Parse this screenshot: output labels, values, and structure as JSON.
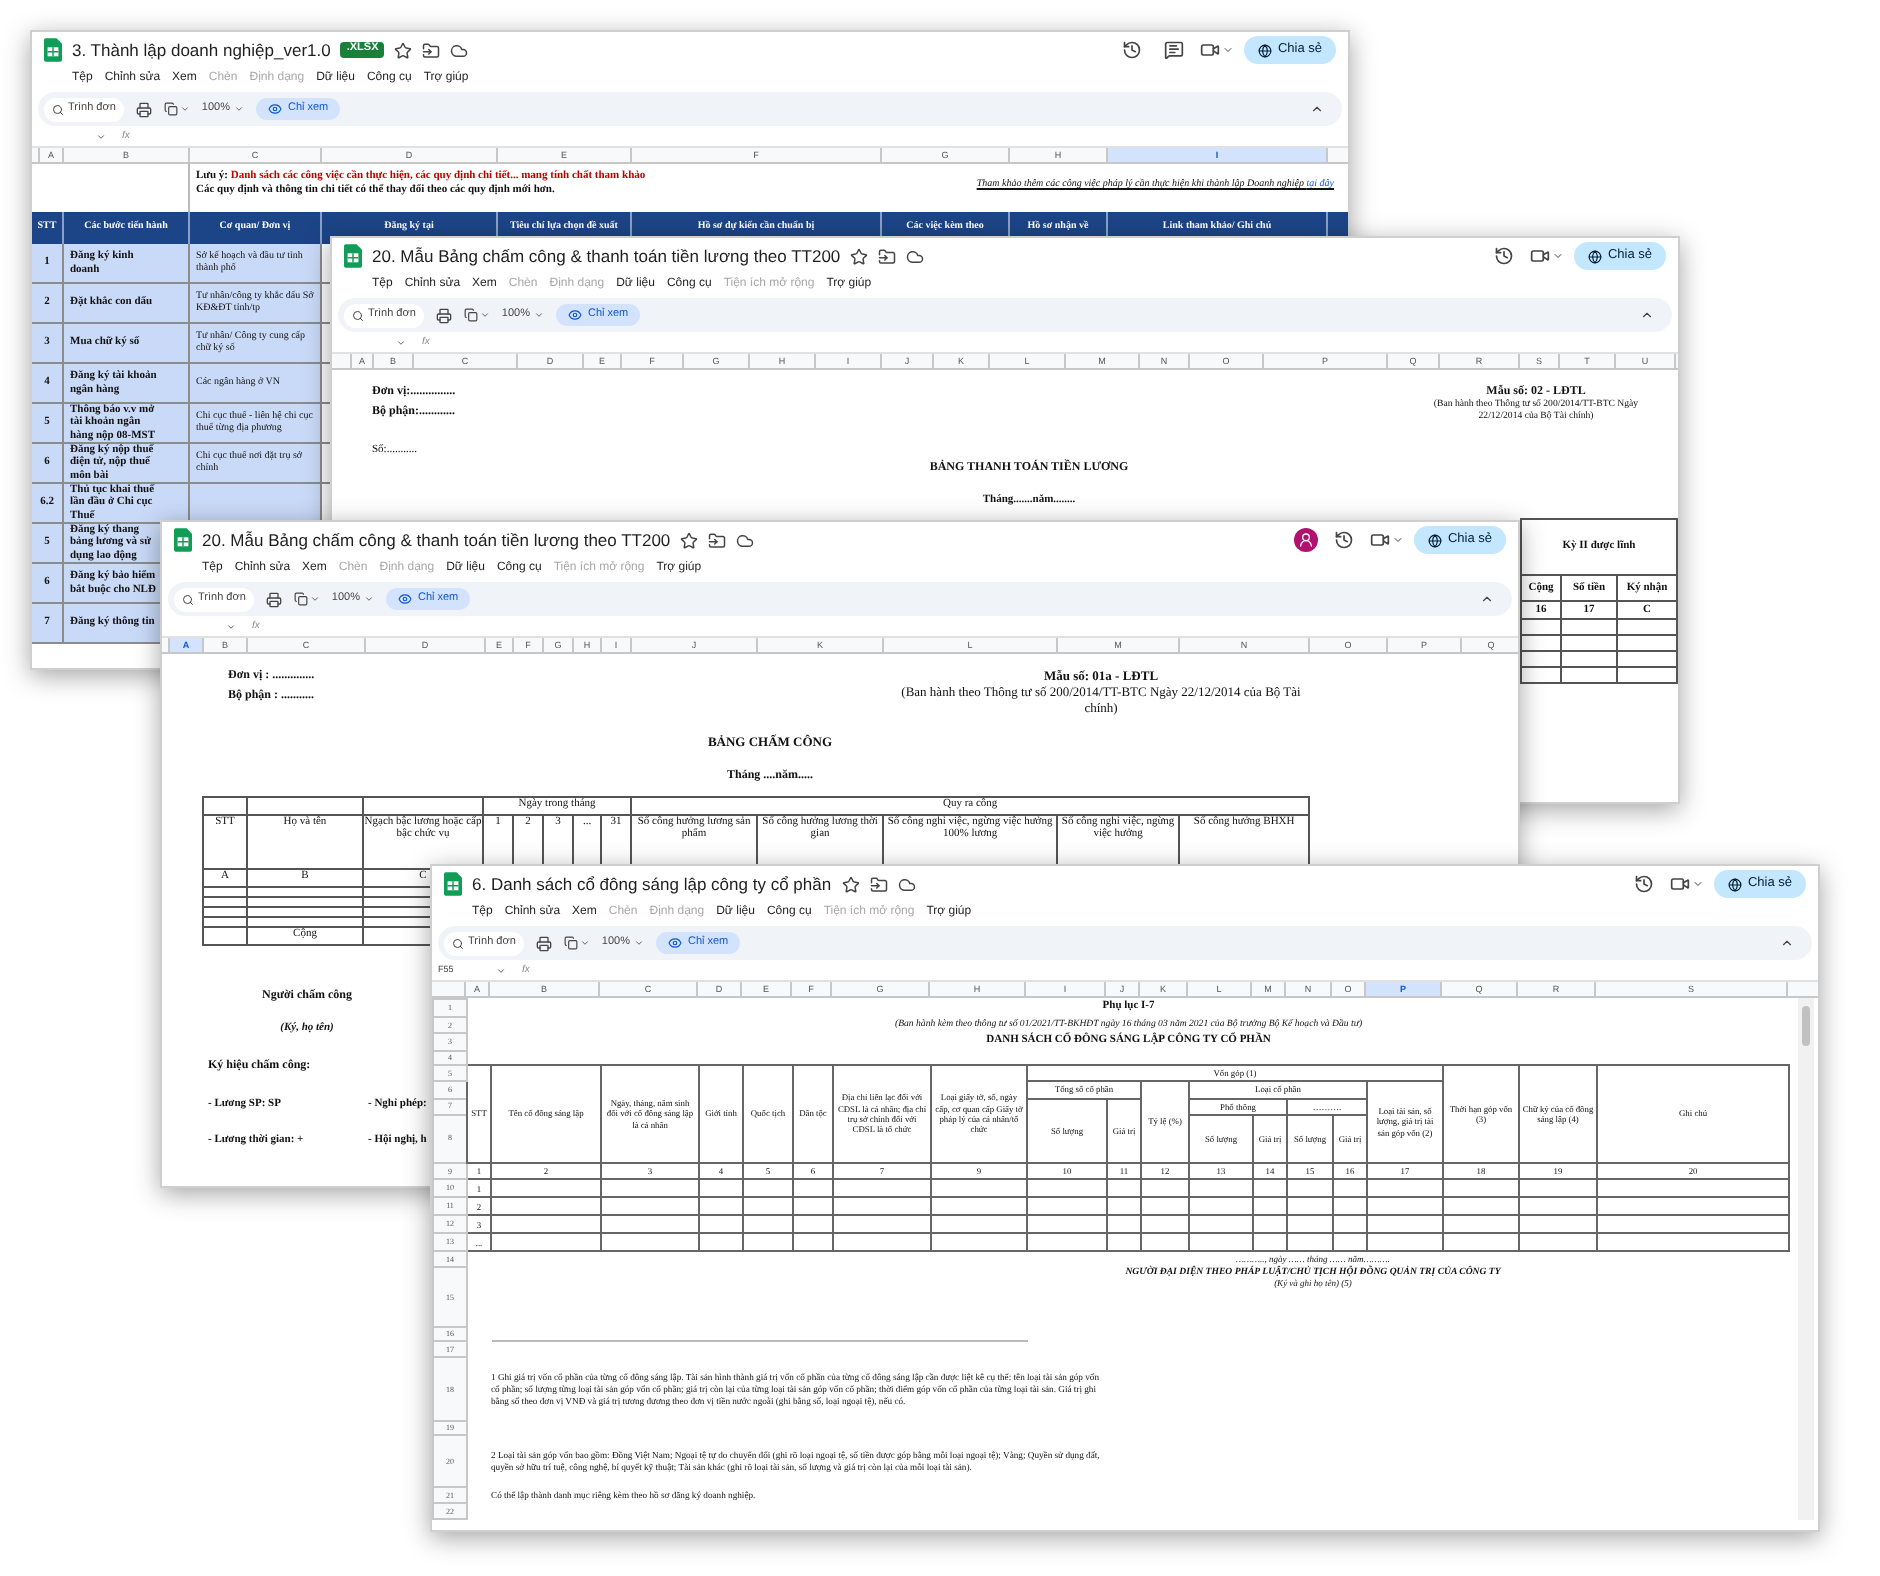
{
  "windows": [
    {
      "kind": "steps",
      "title": "3. Thành lập doanh nghiệp_ver1.0",
      "badge": ".XLSX",
      "avatar": false,
      "comments": true,
      "menu": [
        {
          "label": "Tệp",
          "disabled": false
        },
        {
          "label": "Chỉnh sửa",
          "disabled": false
        },
        {
          "label": "Xem",
          "disabled": false
        },
        {
          "label": "Chèn",
          "disabled": true
        },
        {
          "label": "Định dạng",
          "disabled": true
        },
        {
          "label": "Dữ liệu",
          "disabled": false
        },
        {
          "label": "Công cụ",
          "disabled": false
        },
        {
          "label": "Trợ giúp",
          "disabled": false
        }
      ],
      "search": "Trình đơn",
      "zoom": "100%",
      "mode": "Chỉ xem",
      "share": "Chia sẻ",
      "fx": "fx",
      "columns": [
        {
          "label": "A",
          "selected": false
        },
        {
          "label": "B",
          "selected": false
        },
        {
          "label": "C",
          "selected": false
        },
        {
          "label": "D",
          "selected": false
        },
        {
          "label": "E",
          "selected": false
        },
        {
          "label": "F",
          "selected": false
        },
        {
          "label": "G",
          "selected": false
        },
        {
          "label": "H",
          "selected": false
        },
        {
          "label": "I",
          "selected": true
        }
      ],
      "note": {
        "label": "Lưu ý:",
        "text": "Danh sách các công việc cần thực hiện, các quy định chi tiết... mang tính chất tham khảo",
        "detail": "Các quy định và thông tin chi tiết có thể thay đổi theo các quy định mới hơn."
      },
      "reference": {
        "text": "Tham khảo thêm các công việc pháp lý cần thực hiện khi thành lập Doanh nghiệp",
        "link": "tại đây"
      },
      "headers": [
        "STT",
        "Các bước tiến hành",
        "Cơ quan/ Đơn vị",
        "Đăng ký tại",
        "Tiêu chí lựa chọn đề xuất",
        "Hồ sơ dự kiến cần chuẩn bị",
        "Các việc kèm theo",
        "Hồ sơ nhận về",
        "Link tham khảo/ Ghi chú"
      ],
      "rows": [
        {
          "stt": "1",
          "step": "Đăng ký kinh doanh",
          "agency": "Sở kế hoạch và đầu tư tỉnh thành phố"
        },
        {
          "stt": "2",
          "step": "Đặt khắc con dấu",
          "agency": "Tư nhân/công ty khắc dấu Sở KĐ&ĐT tỉnh/tp"
        },
        {
          "stt": "3",
          "step": "Mua chữ ký số",
          "agency": "Tư nhân/ Công ty cung cấp chữ ký số"
        },
        {
          "stt": "4",
          "step": "Đăng ký tài khoản ngân hàng",
          "agency": "Các ngân hàng ở VN"
        },
        {
          "stt": "5",
          "step": "Thông báo v.v mở tài khoản ngân hàng nộp 08-MST",
          "agency": "Chi cục thuế - liên hệ chi cục thuế từng địa phương"
        },
        {
          "stt": "6",
          "step": "Đăng ký nộp thuế điện tử, nộp thuế môn bài",
          "agency": "Chi cục thuế nơi đặt trụ sở chính"
        },
        {
          "stt": "6.2",
          "step": "Thủ tục khai thuế lần đầu ở Chi cục Thuế"
        },
        {
          "stt": "5",
          "step": "Đăng ký thang bảng lương và sử dụng lao động"
        },
        {
          "stt": "6",
          "step": "Đăng ký bảo hiểm bắt buộc cho NLĐ"
        },
        {
          "stt": "7",
          "step": "Đăng ký thông tin"
        }
      ]
    },
    {
      "kind": "payroll",
      "title": "20. Mẫu Bảng chấm công & thanh toán tiền lương theo TT200",
      "avatar": false,
      "comments": false,
      "menu": [
        {
          "label": "Tệp",
          "disabled": false
        },
        {
          "label": "Chỉnh sửa",
          "disabled": false
        },
        {
          "label": "Xem",
          "disabled": false
        },
        {
          "label": "Chèn",
          "disabled": true
        },
        {
          "label": "Định dạng",
          "disabled": true
        },
        {
          "label": "Dữ liệu",
          "disabled": false
        },
        {
          "label": "Công cụ",
          "disabled": false
        },
        {
          "label": "Tiện ích mở rộng",
          "disabled": true
        },
        {
          "label": "Trợ giúp",
          "disabled": false
        }
      ],
      "search": "Trình đơn",
      "zoom": "100%",
      "mode": "Chỉ xem",
      "share": "Chia sẻ",
      "fx": "fx",
      "columns": [
        {
          "label": "A",
          "selected": false
        },
        {
          "label": "B",
          "selected": false
        },
        {
          "label": "C",
          "selected": false
        },
        {
          "label": "D",
          "selected": false
        },
        {
          "label": "E",
          "selected": false
        },
        {
          "label": "F",
          "selected": false
        },
        {
          "label": "G",
          "selected": false
        },
        {
          "label": "H",
          "selected": false
        },
        {
          "label": "I",
          "selected": false
        },
        {
          "label": "J",
          "selected": false
        },
        {
          "label": "K",
          "selected": false
        },
        {
          "label": "L",
          "selected": false
        },
        {
          "label": "M",
          "selected": false
        },
        {
          "label": "N",
          "selected": false
        },
        {
          "label": "O",
          "selected": false
        },
        {
          "label": "P",
          "selected": false
        },
        {
          "label": "Q",
          "selected": false
        },
        {
          "label": "R",
          "selected": false
        },
        {
          "label": "S",
          "selected": false
        },
        {
          "label": "T",
          "selected": false
        },
        {
          "label": "U",
          "selected": false
        }
      ],
      "unit": "Đơn vị:...............",
      "department": "Bộ phận:............",
      "number": "Số:...........",
      "form": "Mẫu số: 02 - LĐTL",
      "issued": "(Ban hành theo Thông tư số 200/2014/TT-BTC Ngày 22/12/2014 của Bộ Tài chính)",
      "heading": "BẢNG THANH TOÁN TIỀN LƯƠNG",
      "period": "Tháng.......năm........",
      "fragment": {
        "group": "Kỳ II được lĩnh",
        "headers": [
          "Cộng",
          "Số tiền",
          "Ký nhận"
        ],
        "codes": [
          "16",
          "17",
          "C"
        ]
      }
    },
    {
      "kind": "timesheet",
      "title": "20. Mẫu Bảng chấm công & thanh toán tiền lương theo TT200",
      "avatar": true,
      "comments": false,
      "menu": [
        {
          "label": "Tệp",
          "disabled": false
        },
        {
          "label": "Chỉnh sửa",
          "disabled": false
        },
        {
          "label": "Xem",
          "disabled": false
        },
        {
          "label": "Chèn",
          "disabled": true
        },
        {
          "label": "Định dạng",
          "disabled": true
        },
        {
          "label": "Dữ liệu",
          "disabled": false
        },
        {
          "label": "Công cụ",
          "disabled": false
        },
        {
          "label": "Tiện ích mở rộng",
          "disabled": true
        },
        {
          "label": "Trợ giúp",
          "disabled": false
        }
      ],
      "search": "Trình đơn",
      "zoom": "100%",
      "mode": "Chỉ xem",
      "share": "Chia sẻ",
      "fx": "fx",
      "columns": [
        {
          "label": "A",
          "selected": true
        },
        {
          "label": "B",
          "selected": false
        },
        {
          "label": "C",
          "selected": false
        },
        {
          "label": "D",
          "selected": false
        },
        {
          "label": "E",
          "selected": false
        },
        {
          "label": "F",
          "selected": false
        },
        {
          "label": "G",
          "selected": false
        },
        {
          "label": "H",
          "selected": false
        },
        {
          "label": "I",
          "selected": false
        },
        {
          "label": "J",
          "selected": false
        },
        {
          "label": "K",
          "selected": false
        },
        {
          "label": "L",
          "selected": false
        },
        {
          "label": "M",
          "selected": false
        },
        {
          "label": "N",
          "selected": false
        },
        {
          "label": "O",
          "selected": false
        },
        {
          "label": "P",
          "selected": false
        },
        {
          "label": "Q",
          "selected": false
        }
      ],
      "unit": "Đơn vị : ..............",
      "department": "Bộ phận : ...........",
      "form": "Mẫu số: 01a - LĐTL",
      "issued": "(Ban hành theo Thông tư số 200/2014/TT-BTC Ngày 22/12/2014 của Bộ Tài chính)",
      "heading": "BẢNG CHẤM CÔNG",
      "period": "Tháng ....năm.....",
      "table": {
        "days_group": "Ngày trong tháng",
        "work_group": "Quy ra công",
        "headers": [
          "STT",
          "Họ và tên",
          "Ngạch bậc lương hoặc cấp bậc chức vụ"
        ],
        "days": [
          "1",
          "2",
          "3",
          "...",
          "31"
        ],
        "work": [
          "Số công hưởng lương sản phẩm",
          "Số công hưởng lương thời gian",
          "Số công nghỉ việc, ngừng việc hưởng 100% lương",
          "Số công nghỉ việc, ngừng việc hưởng",
          "Số công hưởng BHXH"
        ],
        "codes": [
          "A",
          "B",
          "C"
        ],
        "total": "Cộng"
      },
      "signer": "Người chấm công",
      "sign_hint": "(Ký, họ tên)",
      "legend_title": "Ký hiệu chấm công:",
      "legend": [
        "- Lương SP:  SP",
        "- Nghỉ phép:",
        "- Lương thời gian: +",
        "- Hội nghị, h"
      ]
    },
    {
      "kind": "shareholders",
      "title": "6. Danh sách cổ đông sáng lập công ty cổ phần",
      "avatar": false,
      "comments": false,
      "menu": [
        {
          "label": "Tệp",
          "disabled": false
        },
        {
          "label": "Chỉnh sửa",
          "disabled": false
        },
        {
          "label": "Xem",
          "disabled": false
        },
        {
          "label": "Chèn",
          "disabled": true
        },
        {
          "label": "Định dạng",
          "disabled": true
        },
        {
          "label": "Dữ liệu",
          "disabled": false
        },
        {
          "label": "Công cụ",
          "disabled": false
        },
        {
          "label": "Tiện ích mở rộng",
          "disabled": true
        },
        {
          "label": "Trợ giúp",
          "disabled": false
        }
      ],
      "search": "Trình đơn",
      "zoom": "100%",
      "mode": "Chỉ xem",
      "share": "Chia sẻ",
      "fx": "fx",
      "cell_ref": "F55",
      "columns": [
        {
          "label": "A",
          "selected": false
        },
        {
          "label": "B",
          "selected": false
        },
        {
          "label": "C",
          "selected": false
        },
        {
          "label": "D",
          "selected": false
        },
        {
          "label": "E",
          "selected": false
        },
        {
          "label": "F",
          "selected": false
        },
        {
          "label": "G",
          "selected": false
        },
        {
          "label": "H",
          "selected": false
        },
        {
          "label": "I",
          "selected": false
        },
        {
          "label": "J",
          "selected": false
        },
        {
          "label": "K",
          "selected": false
        },
        {
          "label": "L",
          "selected": false
        },
        {
          "label": "M",
          "selected": false
        },
        {
          "label": "N",
          "selected": false
        },
        {
          "label": "O",
          "selected": false
        },
        {
          "label": "P",
          "selected": true
        },
        {
          "label": "Q",
          "selected": false
        },
        {
          "label": "R",
          "selected": false
        },
        {
          "label": "S",
          "selected": false
        }
      ],
      "row_numbers": [
        "1",
        "2",
        "3",
        "4",
        "5",
        "6",
        "7",
        "8",
        "9",
        "10",
        "11",
        "12",
        "13",
        "14",
        "15",
        "16",
        "17",
        "18",
        "19",
        "20",
        "21",
        "22"
      ],
      "appendix": "Phụ lục I-7",
      "issued": "(Ban hành kèm theo thông tư số 01/2021/TT-BKHĐT ngày 16 tháng 03 năm 2021 của Bộ trưởng Bộ Kế hoạch và Đầu tư)",
      "heading": "DANH SÁCH CỔ ĐÔNG SÁNG LẬP CÔNG TY CỔ PHẦN",
      "header": [
        "STT",
        "Tên cổ đông sáng lập",
        "Ngày, tháng, năm sinh đối với cổ đông sáng lập là cá nhân",
        "Giới tính",
        "Quốc tịch",
        "Dân tộc",
        "Địa chỉ liên lạc đối với CĐSL là cá nhân; địa chỉ trụ sở chính đối với CĐSL là tổ chức",
        "Loại giấy tờ, số, ngày cấp, cơ quan cấp Giấy tờ pháp lý của cá nhân/tổ chức",
        "Vốn góp (1)",
        "Tổng số cổ phần",
        "Số lượng",
        "Giá trị",
        "Tỷ lệ (%)",
        "Loại cổ phần",
        "Phổ thông",
        "Số lượng",
        "Giá trị",
        "……….",
        "Số lượng",
        "Giá trị",
        "Loại tài sản, số lượng, giá trị tài sản góp vốn (2)",
        "Thời hạn góp vốn (3)",
        "Chữ ký của cổ đông sáng lập (4)",
        "Ghi chú"
      ],
      "numbers": [
        "1",
        "2",
        "3",
        "4",
        "5",
        "6",
        "7",
        "9",
        "10",
        "11",
        "12",
        "13",
        "14",
        "15",
        "16",
        "17",
        "18",
        "19",
        "20"
      ],
      "rows": [
        "1",
        "2",
        "3",
        "..."
      ],
      "date_line": "……….., ngày …… tháng …… năm……….",
      "representative": "NGƯỜI ĐẠI DIỆN THEO PHÁP LUẬT/CHỦ TỊCH HỘI ĐỒNG QUẢN TRỊ CỦA CÔNG TY",
      "sign_hint": "(Ký và ghi họ tên) (5)",
      "notes": [
        "1 Ghi giá trị vốn cổ phần của từng cổ đông sáng lập. Tài sản hình thành giá trị vốn cổ phần của từng cổ đông sáng lập cần được liệt kê cụ thể: tên loại tài sản góp vốn cổ phần; số lượng từng loại tài sản góp vốn cổ phần; giá trị còn lại của từng loại tài sản góp vốn cổ phần; thời điểm góp vốn cổ phần của từng loại tài sản. Giá trị ghi bằng số theo đơn vị VNĐ và giá trị tương đương theo đơn vị tiền nước ngoài (ghi bằng số, loại ngoại tệ), nếu có.",
        "2 Loại tài sản góp vốn bao gồm: Đồng Việt Nam; Ngoại tệ tự do chuyển đổi (ghi rõ loại ngoại tệ, số tiền được góp bằng mỗi loại ngoại tệ); Vàng; Quyền sử dụng đất, quyền sở hữu trí tuệ, công nghệ, bí quyết kỹ thuật; Tài sản khác (ghi rõ loại tài sản, số lượng và giá trị còn lại của mỗi loại tài sản).",
        "Có thể lập thành danh mục riêng kèm theo hồ sơ đăng ký doanh nghiệp."
      ]
    }
  ]
}
